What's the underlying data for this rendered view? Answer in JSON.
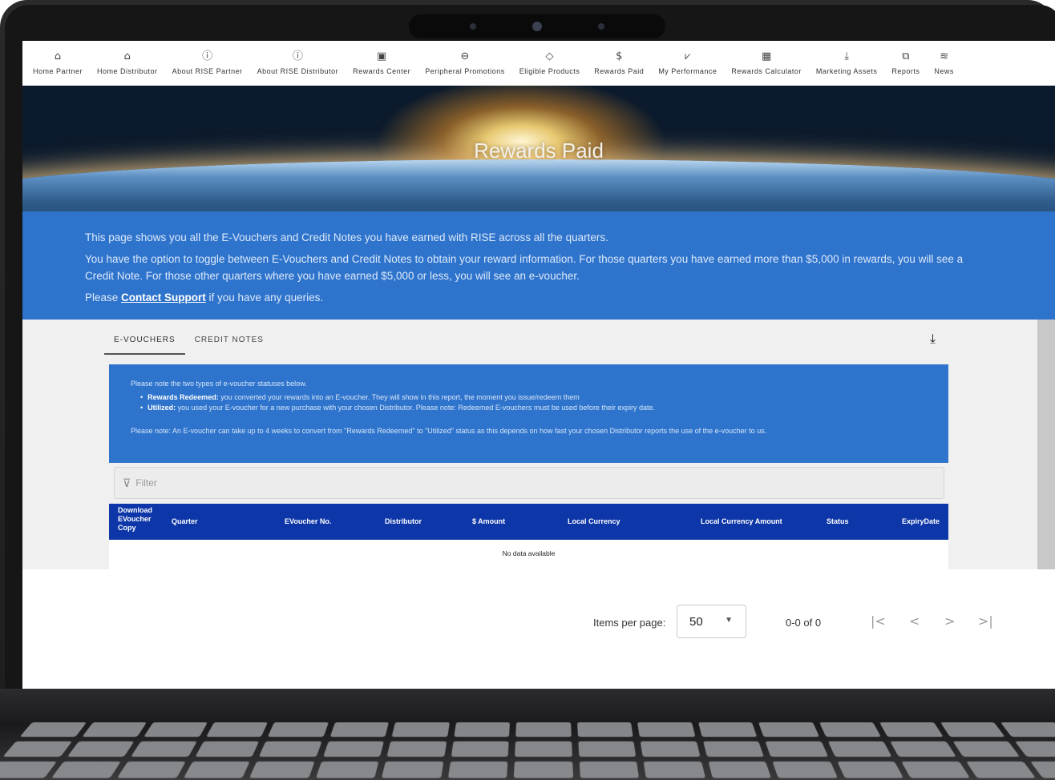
{
  "nav": [
    {
      "icon": "home-icon",
      "glyph": "⌂",
      "label": "Home Partner"
    },
    {
      "icon": "home-icon",
      "glyph": "⌂",
      "label": "Home Distributor"
    },
    {
      "icon": "info-icon",
      "glyph": "ⓘ",
      "label": "About RISE Partner"
    },
    {
      "icon": "info-icon",
      "glyph": "ⓘ",
      "label": "About RISE Distributor"
    },
    {
      "icon": "calendar-icon",
      "glyph": "▣",
      "label": "Rewards Center"
    },
    {
      "icon": "mouse-icon",
      "glyph": "⊖",
      "label": "Peripheral Promotions"
    },
    {
      "icon": "tag-icon",
      "glyph": "◇",
      "label": "Eligible Products"
    },
    {
      "icon": "dollar-icon",
      "glyph": "$",
      "label": "Rewards Paid"
    },
    {
      "icon": "chart-icon",
      "glyph": "⩗",
      "label": "My Performance"
    },
    {
      "icon": "calculator-icon",
      "glyph": "▦",
      "label": "Rewards Calculator"
    },
    {
      "icon": "download-icon",
      "glyph": "⤓",
      "label": "Marketing Assets"
    },
    {
      "icon": "reports-icon",
      "glyph": "⧉",
      "label": "Reports"
    },
    {
      "icon": "wifi-icon",
      "glyph": "≋",
      "label": "News"
    }
  ],
  "hero": {
    "title": "Rewards Paid"
  },
  "info": {
    "line1": "This page shows you all the E-Vouchers and Credit Notes you have earned with RISE across all the quarters.",
    "line2": "You have the option to toggle between E-Vouchers and Credit Notes to obtain your reward information. For those quarters you have earned more than $5,000 in rewards, you will see a Credit Note. For those other quarters where you have earned $5,000 or less, you will see an e-voucher.",
    "line3_prefix": "Please ",
    "line3_link": "Contact Support",
    "line3_suffix": " if you have any queries."
  },
  "tabs": [
    {
      "label": "E-VOUCHERS",
      "active": true
    },
    {
      "label": "CREDIT NOTES",
      "active": false
    }
  ],
  "download_glyph": "⤓",
  "notice": {
    "intro": "Please note the two types of e-voucher statuses below.",
    "items": [
      {
        "term": "Rewards Redeemed:",
        "text": " you converted your rewards into an E-voucher. They will show in this report, the moment you issue/redeem them"
      },
      {
        "term": "Utilized:",
        "text": " you used your E-voucher for a new purchase with your chosen Distributor. Please note: Redeemed E-vouchers must be used before their expiry date."
      }
    ],
    "footer": "Please note: An E-voucher can take up to 4 weeks to convert from \"Rewards Redeemed\" to \"Utilized\" status as this depends on how fast your chosen Distributor reports the use of the e-voucher to us."
  },
  "filter": {
    "icon": "filter-icon",
    "placeholder": "Filter"
  },
  "table": {
    "columns": [
      {
        "label": "Download EVoucher Copy"
      },
      {
        "label": "Quarter"
      },
      {
        "label": "EVoucher No."
      },
      {
        "label": "Distributor"
      },
      {
        "label": "$ Amount"
      },
      {
        "label": "Local Currency"
      },
      {
        "label": "Local Currency Amount"
      },
      {
        "label": "Status"
      },
      {
        "label": "ExpiryDate"
      }
    ],
    "empty": "No data available"
  },
  "pager": {
    "items_per_page_label": "Items per page:",
    "items_per_page": "50",
    "range": "0-0 of 0",
    "first": "|<",
    "prev": "<",
    "next": ">",
    "last": ">|"
  }
}
